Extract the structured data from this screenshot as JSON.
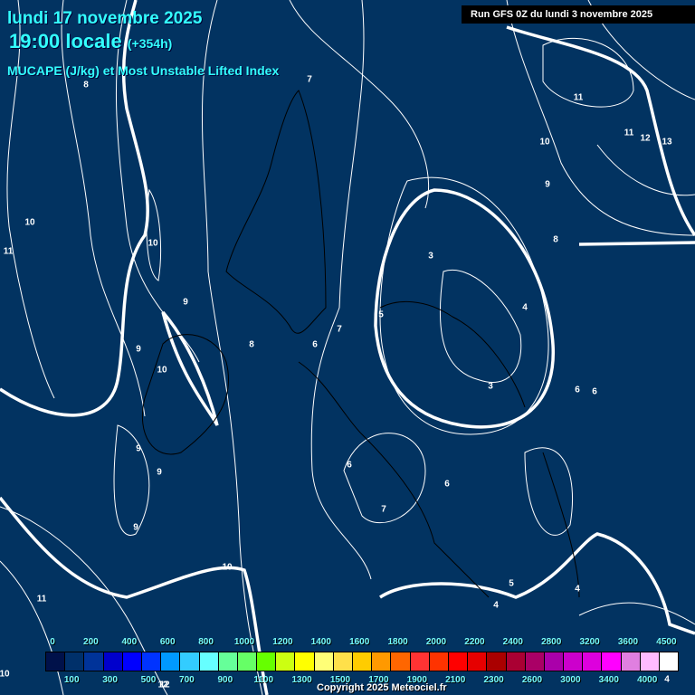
{
  "header": {
    "date": "lundi 17 novembre 2025",
    "time": "19:00 locale",
    "lead": "(+354h)",
    "parameter": "MUCAPE (J/kg) et Most Unstable Lifted Index",
    "run": "Run GFS 0Z du lundi 3 novembre 2025"
  },
  "contour_labels": [
    "8",
    "10",
    "11",
    "10",
    "9",
    "9",
    "10",
    "9",
    "9",
    "9",
    "8",
    "7",
    "6",
    "7",
    "5",
    "3",
    "4",
    "3",
    "6",
    "6",
    "6",
    "7",
    "6",
    "11",
    "12",
    "11",
    "10",
    "11",
    "12",
    "13",
    "10",
    "9",
    "8",
    "5",
    "4",
    "4",
    "4",
    "10",
    "12"
  ],
  "colorbar": {
    "top_ticks": [
      "0",
      "200",
      "400",
      "600",
      "800",
      "1000",
      "1200",
      "1400",
      "1600",
      "1800",
      "2000",
      "2200",
      "2400",
      "2800",
      "3200",
      "3600",
      "4500"
    ],
    "bottom_ticks": [
      "100",
      "300",
      "500",
      "700",
      "900",
      "1100",
      "1300",
      "1500",
      "1700",
      "1900",
      "2100",
      "2300",
      "2600",
      "3000",
      "3400",
      "4000"
    ],
    "colors": [
      "#00114a",
      "#00306a",
      "#003399",
      "#0000cc",
      "#0000ff",
      "#0033ff",
      "#0099ff",
      "#33ccff",
      "#66ffff",
      "#66ff99",
      "#66ff66",
      "#66ff00",
      "#ccff11",
      "#ffff00",
      "#ffff77",
      "#ffe04a",
      "#ffcc00",
      "#ff9900",
      "#ff6600",
      "#ff3333",
      "#ff3300",
      "#ff0000",
      "#e60000",
      "#aa0000",
      "#aa0033",
      "#aa0066",
      "#aa00aa",
      "#cc00cc",
      "#dd00dd",
      "#ff00ff",
      "#e07fe0",
      "#ffbbff",
      "#ffffff"
    ]
  },
  "copyright": "Copyright 2025 Meteociel.fr"
}
